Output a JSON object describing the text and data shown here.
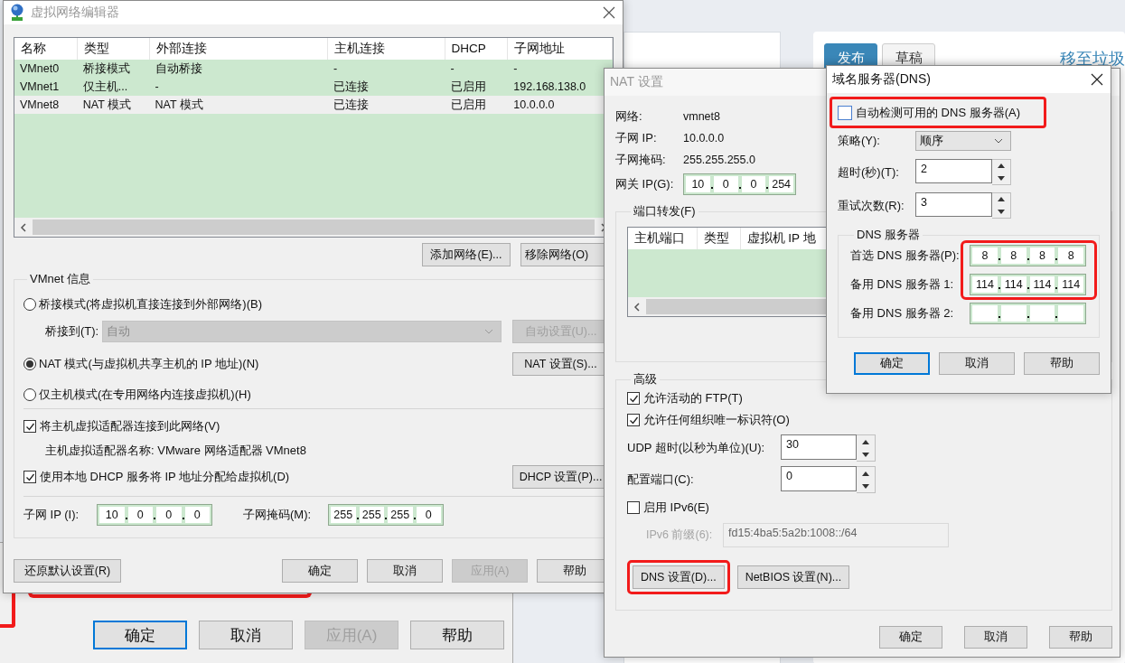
{
  "background_page": {
    "tabs": [
      {
        "label": "发布",
        "selected": true
      },
      {
        "label": "草稿",
        "selected": false
      }
    ],
    "link": "移至垃圾"
  },
  "back_dialog": {
    "highlighted": true,
    "buttons": [
      {
        "label": "确定",
        "default": true,
        "disabled": false
      },
      {
        "label": "取消",
        "default": false,
        "disabled": false
      },
      {
        "label": "应用(A)",
        "default": false,
        "disabled": true
      },
      {
        "label": "帮助",
        "default": false,
        "disabled": false
      }
    ]
  },
  "editor": {
    "title": "虚拟网络编辑器",
    "table": {
      "columns": [
        "名称",
        "类型",
        "外部连接",
        "主机连接",
        "DHCP",
        "子网地址"
      ],
      "rows": [
        {
          "cells": [
            "VMnet0",
            "桥接模式",
            "自动桥接",
            "-",
            "-",
            "-"
          ],
          "selected": false
        },
        {
          "cells": [
            "VMnet1",
            "仅主机...",
            "-",
            "已连接",
            "已启用",
            "192.168.138.0"
          ],
          "selected": false
        },
        {
          "cells": [
            "VMnet8",
            "NAT 模式",
            "NAT 模式",
            "已连接",
            "已启用",
            "10.0.0.0"
          ],
          "selected": true
        }
      ]
    },
    "buttons": [
      "添加网络(E)...",
      "移除网络(O)"
    ],
    "info": {
      "title": "VMnet 信息",
      "modes": [
        {
          "label": "桥接模式(将虚拟机直接连接到外部网络)(B)",
          "selected": false
        },
        {
          "label": "NAT 模式(与虚拟机共享主机的 IP 地址)(N)",
          "selected": true,
          "button": "NAT 设置(S)..."
        },
        {
          "label": "仅主机模式(在专用网络内连接虚拟机)(H)",
          "selected": false
        }
      ],
      "bridge_to": {
        "label": "桥接到(T):",
        "value": "自动",
        "disabled": true,
        "button": "自动设置(U)..."
      },
      "connect_adapter": {
        "label": "将主机虚拟适配器连接到此网络(V)",
        "checked": true
      },
      "adapter_name": "主机虚拟适配器名称: VMware 网络适配器 VMnet8",
      "dhcp": {
        "label": "使用本地 DHCP 服务将 IP 地址分配给虚拟机(D)",
        "checked": true,
        "button": "DHCP 设置(P)..."
      },
      "subnet_ip": {
        "label": "子网 IP (I):",
        "octets": [
          "10",
          "0",
          "0",
          "0"
        ]
      },
      "subnet_mask": {
        "label": "子网掩码(M):",
        "octets": [
          "255",
          "255",
          "255",
          "0"
        ]
      }
    },
    "restore_button": "还原默认设置(R)",
    "footer_buttons": [
      {
        "label": "确定",
        "disabled": false
      },
      {
        "label": "取消",
        "disabled": false
      },
      {
        "label": "应用(A)",
        "disabled": true
      },
      {
        "label": "帮助",
        "disabled": false
      }
    ]
  },
  "nat_dialog": {
    "title": "NAT 设置",
    "info": [
      {
        "label": "网络:",
        "value": "vmnet8"
      },
      {
        "label": "子网 IP:",
        "value": "10.0.0.0"
      },
      {
        "label": "子网掩码:",
        "value": "255.255.255.0"
      }
    ],
    "gateway": {
      "label": "网关 IP(G):",
      "octets": [
        "10",
        "0",
        "0",
        "254"
      ]
    },
    "port_forwarding": {
      "title": "端口转发(F)",
      "columns": [
        "主机端口",
        "类型",
        "虚拟机 IP 地"
      ]
    },
    "advanced": {
      "title": "高级",
      "checks": [
        {
          "label": "允许活动的 FTP(T)",
          "checked": true
        },
        {
          "label": "允许任何组织唯一标识符(O)",
          "checked": true
        }
      ],
      "spinners": [
        {
          "label": "UDP 超时(以秒为单位)(U):",
          "value": "30"
        },
        {
          "label": "配置端口(C):",
          "value": "0"
        }
      ],
      "ipv6": {
        "label": "启用 IPv6(E)",
        "checked": false
      },
      "prefix": {
        "label": "IPv6 前缀(6):",
        "value": "fd15:4ba5:5a2b:1008::/64",
        "disabled": true
      },
      "buttons": [
        {
          "label": "DNS 设置(D)...",
          "highlighted": true
        },
        {
          "label": "NetBIOS 设置(N)...",
          "highlighted": false
        }
      ]
    },
    "buttons": [
      "确定",
      "取消",
      "帮助"
    ]
  },
  "dns_dialog": {
    "title": "域名服务器(DNS)",
    "auto_detect": {
      "label": "自动检测可用的 DNS 服务器(A)",
      "checked": false,
      "highlighted": true
    },
    "policy": {
      "label": "策略(Y):",
      "value": "顺序"
    },
    "spinners": [
      {
        "label": "超时(秒)(T):",
        "value": "2"
      },
      {
        "label": "重试次数(R):",
        "value": "3"
      }
    ],
    "servers": {
      "title": "DNS 服务器",
      "rows": [
        {
          "label": "首选 DNS 服务器(P):",
          "octets": [
            "8",
            "8",
            "8",
            "8"
          ],
          "highlighted": true
        },
        {
          "label": "备用 DNS 服务器 1:",
          "octets": [
            "114",
            "114",
            "114",
            "114"
          ],
          "highlighted": true
        },
        {
          "label": "备用 DNS 服务器 2:",
          "highlighted": false
        }
      ]
    },
    "buttons": [
      {
        "label": "确定",
        "default": true
      },
      {
        "label": "取消",
        "default": false
      },
      {
        "label": "帮助",
        "default": false
      }
    ]
  }
}
